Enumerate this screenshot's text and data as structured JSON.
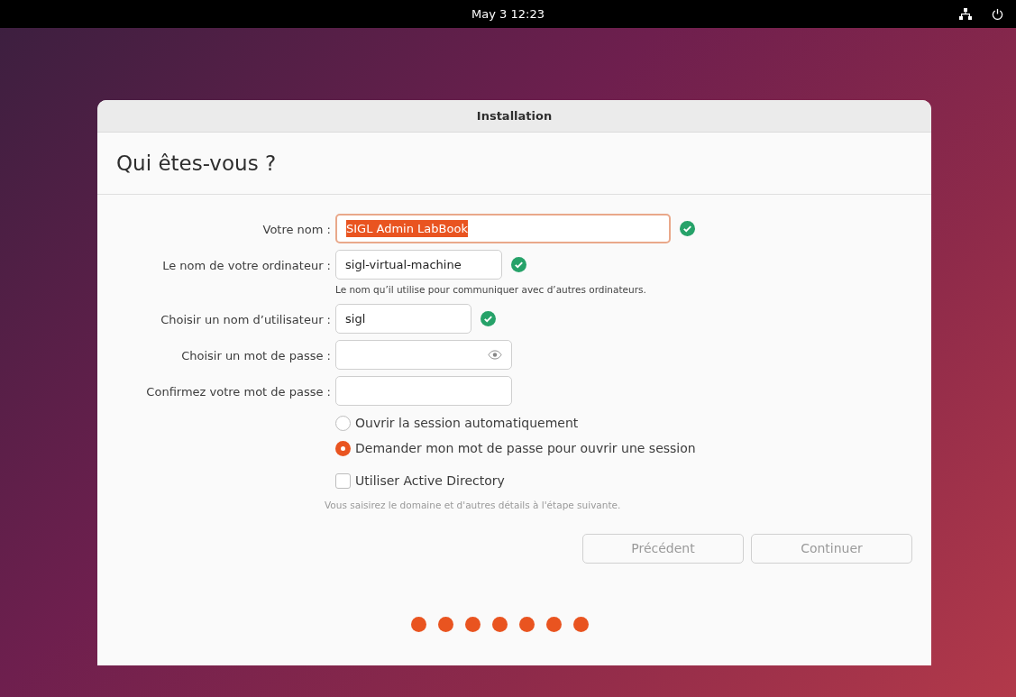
{
  "top_bar": {
    "clock": "May 3  12:23"
  },
  "window": {
    "title": "Installation"
  },
  "heading": "Qui êtes-vous ?",
  "fields": [
    {
      "label": "Votre nom :",
      "value": "SIGL Admin LabBook",
      "kind": "text",
      "highlighted": true,
      "valid": true
    },
    {
      "label": "Le nom de votre ordinateur :",
      "value": "sigl-virtual-machine",
      "kind": "text",
      "highlighted": false,
      "valid": true,
      "hint": "Le nom qu’il utilise pour communiquer avec d’autres ordinateurs."
    },
    {
      "label": "Choisir un nom d’utilisateur :",
      "value": "sigl",
      "kind": "text",
      "highlighted": false,
      "valid": true
    },
    {
      "label": "Choisir un mot de passe :",
      "kind": "password",
      "highlighted": false,
      "valid": false
    },
    {
      "label": "Confirmez votre mot de passe :",
      "kind": "confirm",
      "highlighted": false,
      "valid": false
    }
  ],
  "login_options": [
    {
      "label": "Ouvrir la session automatiquement",
      "selected": false
    },
    {
      "label": "Demander mon mot de passe pour ouvrir une session",
      "selected": true
    }
  ],
  "active_directory": {
    "label": "Utiliser Active Directory",
    "checked": false,
    "hint": "Vous saisirez le domaine et d'autres détails à l'étape suivante."
  },
  "buttons": [
    {
      "label": "Précédent",
      "disabled": true
    },
    {
      "label": "Continuer",
      "disabled": true
    }
  ],
  "progress_steps": [
    {
      "done": true
    },
    {
      "done": true
    },
    {
      "done": true
    },
    {
      "done": true
    },
    {
      "done": true
    },
    {
      "done": true
    },
    {
      "done": true
    }
  ]
}
